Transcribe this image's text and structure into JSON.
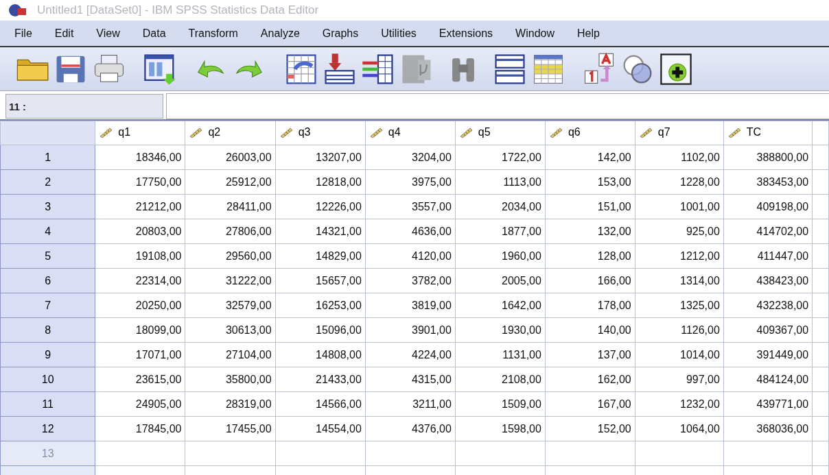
{
  "window": {
    "title": "Untitled1 [DataSet0] - IBM SPSS Statistics Data Editor"
  },
  "menu": [
    "File",
    "Edit",
    "View",
    "Data",
    "Transform",
    "Analyze",
    "Graphs",
    "Utilities",
    "Extensions",
    "Window",
    "Help"
  ],
  "toolbar": [
    {
      "kind": "open"
    },
    {
      "kind": "save"
    },
    {
      "kind": "print"
    },
    {
      "kind": "dialog"
    },
    {
      "kind": "undo"
    },
    {
      "kind": "redo"
    },
    {
      "kind": "goto-case"
    },
    {
      "kind": "goto-variable"
    },
    {
      "kind": "variables"
    },
    {
      "kind": "run",
      "disabled": true
    },
    {
      "kind": "find"
    },
    {
      "kind": "split"
    },
    {
      "kind": "select"
    },
    {
      "kind": "labels"
    },
    {
      "kind": "sets"
    },
    {
      "kind": "custom"
    }
  ],
  "cell_editor": {
    "reference": "11 :"
  },
  "table": {
    "columns": [
      "q1",
      "q2",
      "q3",
      "q4",
      "q5",
      "q6",
      "q7",
      "TC"
    ],
    "rows": [
      {
        "label": "1",
        "cells": [
          "18346,00",
          "26003,00",
          "13207,00",
          "3204,00",
          "1722,00",
          "142,00",
          "1102,00",
          "388800,00"
        ]
      },
      {
        "label": "2",
        "cells": [
          "17750,00",
          "25912,00",
          "12818,00",
          "3975,00",
          "1113,00",
          "153,00",
          "1228,00",
          "383453,00"
        ]
      },
      {
        "label": "3",
        "cells": [
          "21212,00",
          "28411,00",
          "12226,00",
          "3557,00",
          "2034,00",
          "151,00",
          "1001,00",
          "409198,00"
        ]
      },
      {
        "label": "4",
        "cells": [
          "20803,00",
          "27806,00",
          "14321,00",
          "4636,00",
          "1877,00",
          "132,00",
          "925,00",
          "414702,00"
        ]
      },
      {
        "label": "5",
        "cells": [
          "19108,00",
          "29560,00",
          "14829,00",
          "4120,00",
          "1960,00",
          "128,00",
          "1212,00",
          "411447,00"
        ]
      },
      {
        "label": "6",
        "cells": [
          "22314,00",
          "31222,00",
          "15657,00",
          "3782,00",
          "2005,00",
          "166,00",
          "1314,00",
          "438423,00"
        ]
      },
      {
        "label": "7",
        "cells": [
          "20250,00",
          "32579,00",
          "16253,00",
          "3819,00",
          "1642,00",
          "178,00",
          "1325,00",
          "432238,00"
        ]
      },
      {
        "label": "8",
        "cells": [
          "18099,00",
          "30613,00",
          "15096,00",
          "3901,00",
          "1930,00",
          "140,00",
          "1126,00",
          "409367,00"
        ]
      },
      {
        "label": "9",
        "cells": [
          "17071,00",
          "27104,00",
          "14808,00",
          "4224,00",
          "1131,00",
          "137,00",
          "1014,00",
          "391449,00"
        ]
      },
      {
        "label": "10",
        "cells": [
          "23615,00",
          "35800,00",
          "21433,00",
          "4315,00",
          "2108,00",
          "162,00",
          "997,00",
          "484124,00"
        ]
      },
      {
        "label": "11",
        "cells": [
          "24905,00",
          "28319,00",
          "14566,00",
          "3211,00",
          "1509,00",
          "167,00",
          "1232,00",
          "439771,00"
        ]
      },
      {
        "label": "12",
        "cells": [
          "17845,00",
          "17455,00",
          "14554,00",
          "4376,00",
          "1598,00",
          "152,00",
          "1064,00",
          "368036,00"
        ]
      },
      {
        "label": "13",
        "cells": []
      }
    ]
  }
}
